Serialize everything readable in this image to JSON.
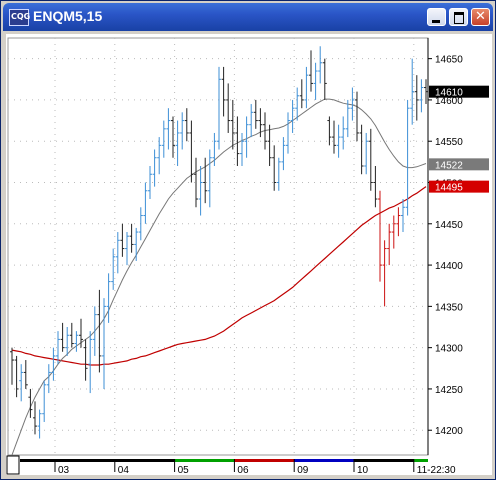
{
  "window": {
    "title": "ENQM5,15",
    "icon_text": "CQG"
  },
  "colors": {
    "up": "#3d8fd6",
    "down": "#222222",
    "red_bar": "#cc1111",
    "ma_fast": "#777777",
    "ma_slow": "#c00000",
    "tag_gray": "#7a7a7a",
    "tag_red": "#d40000",
    "tag_black": "#000000"
  },
  "chart_data": {
    "type": "ohlc",
    "title": "ENQM5,15",
    "ylim": [
      14170,
      14675
    ],
    "y_ticks": [
      "14650",
      "14600",
      "14550",
      "14500",
      "14450",
      "14400",
      "14350",
      "14300",
      "14250",
      "14200"
    ],
    "y_tick_values": [
      14650,
      14600,
      14550,
      14500,
      14450,
      14400,
      14350,
      14300,
      14250,
      14200
    ],
    "tags": [
      {
        "label": "14610",
        "value": 14610,
        "color": "black"
      },
      {
        "label": "14522",
        "value": 14522,
        "color": "gray"
      },
      {
        "label": "14495",
        "value": 14495,
        "color": "red"
      }
    ],
    "date_labels": [
      "03",
      "04",
      "05",
      "06",
      "09",
      "10",
      "11-22:30"
    ],
    "date_label_index": [
      10,
      23,
      36,
      49,
      62,
      75,
      88
    ],
    "date_band_colors": [
      "#000000",
      "#000000",
      "#00a000",
      "#c00000",
      "#0000c0",
      "#000000",
      "#00a000"
    ],
    "bars": [
      [
        14295,
        14300,
        14255,
        14285
      ],
      [
        14285,
        14290,
        14240,
        14250
      ],
      [
        14260,
        14280,
        14235,
        14270
      ],
      [
        14270,
        14285,
        14250,
        14255
      ],
      [
        14240,
        14250,
        14215,
        14225
      ],
      [
        14215,
        14235,
        14195,
        14205
      ],
      [
        14205,
        14225,
        14190,
        14220
      ],
      [
        14220,
        14260,
        14210,
        14255
      ],
      [
        14255,
        14280,
        14245,
        14270
      ],
      [
        14270,
        14300,
        14260,
        14290
      ],
      [
        14290,
        14320,
        14280,
        14310
      ],
      [
        14310,
        14330,
        14295,
        14300
      ],
      [
        14300,
        14325,
        14290,
        14315
      ],
      [
        14315,
        14330,
        14300,
        14305
      ],
      [
        14305,
        14320,
        14295,
        14315
      ],
      [
        14315,
        14335,
        14300,
        14310
      ],
      [
        14300,
        14310,
        14260,
        14275
      ],
      [
        14280,
        14320,
        14245,
        14310
      ],
      [
        14310,
        14350,
        14290,
        14340
      ],
      [
        14340,
        14370,
        14270,
        14290
      ],
      [
        14290,
        14360,
        14250,
        14350
      ],
      [
        14350,
        14390,
        14330,
        14380
      ],
      [
        14380,
        14420,
        14370,
        14410
      ],
      [
        14410,
        14440,
        14390,
        14430
      ],
      [
        14430,
        14450,
        14410,
        14420
      ],
      [
        14420,
        14440,
        14400,
        14435
      ],
      [
        14435,
        14450,
        14415,
        14425
      ],
      [
        14425,
        14445,
        14405,
        14440
      ],
      [
        14440,
        14470,
        14430,
        14460
      ],
      [
        14460,
        14500,
        14450,
        14490
      ],
      [
        14490,
        14520,
        14480,
        14510
      ],
      [
        14510,
        14540,
        14495,
        14530
      ],
      [
        14530,
        14555,
        14510,
        14545
      ],
      [
        14545,
        14575,
        14530,
        14565
      ],
      [
        14565,
        14590,
        14540,
        14575
      ],
      [
        14575,
        14580,
        14530,
        14545
      ],
      [
        14545,
        14575,
        14520,
        14560
      ],
      [
        14560,
        14585,
        14540,
        14575
      ],
      [
        14575,
        14590,
        14550,
        14560
      ],
      [
        14560,
        14575,
        14500,
        14510
      ],
      [
        14510,
        14530,
        14470,
        14480
      ],
      [
        14480,
        14520,
        14460,
        14500
      ],
      [
        14500,
        14530,
        14475,
        14490
      ],
      [
        14490,
        14540,
        14470,
        14530
      ],
      [
        14530,
        14560,
        14520,
        14550
      ],
      [
        14550,
        14640,
        14540,
        14625
      ],
      [
        14625,
        14640,
        14580,
        14600
      ],
      [
        14600,
        14620,
        14560,
        14575
      ],
      [
        14575,
        14600,
        14540,
        14560
      ],
      [
        14560,
        14580,
        14520,
        14535
      ],
      [
        14535,
        14560,
        14520,
        14550
      ],
      [
        14550,
        14580,
        14530,
        14570
      ],
      [
        14570,
        14595,
        14555,
        14585
      ],
      [
        14585,
        14600,
        14565,
        14575
      ],
      [
        14575,
        14590,
        14555,
        14570
      ],
      [
        14570,
        14585,
        14540,
        14550
      ],
      [
        14550,
        14570,
        14520,
        14530
      ],
      [
        14530,
        14545,
        14490,
        14500
      ],
      [
        14500,
        14530,
        14490,
        14525
      ],
      [
        14525,
        14555,
        14515,
        14545
      ],
      [
        14545,
        14585,
        14535,
        14575
      ],
      [
        14575,
        14600,
        14560,
        14590
      ],
      [
        14590,
        14615,
        14575,
        14605
      ],
      [
        14605,
        14625,
        14590,
        14600
      ],
      [
        14600,
        14640,
        14590,
        14630
      ],
      [
        14630,
        14660,
        14610,
        14620
      ],
      [
        14620,
        14645,
        14600,
        14635
      ],
      [
        14635,
        14665,
        14620,
        14645
      ],
      [
        14645,
        14650,
        14600,
        14620
      ],
      [
        14575,
        14580,
        14545,
        14555
      ],
      [
        14555,
        14575,
        14535,
        14545
      ],
      [
        14545,
        14570,
        14530,
        14555
      ],
      [
        14555,
        14580,
        14540,
        14565
      ],
      [
        14565,
        14600,
        14555,
        14590
      ],
      [
        14590,
        14615,
        14575,
        14600
      ],
      [
        14600,
        14610,
        14550,
        14560
      ],
      [
        14560,
        14570,
        14510,
        14520
      ],
      [
        14520,
        14560,
        14510,
        14550
      ],
      [
        14550,
        14565,
        14490,
        14500
      ],
      [
        14500,
        14520,
        14470,
        14480
      ],
      [
        14480,
        14490,
        14380,
        14400
      ],
      [
        14400,
        14430,
        14350,
        14420
      ],
      [
        14420,
        14450,
        14400,
        14440
      ],
      [
        14440,
        14460,
        14420,
        14450
      ],
      [
        14450,
        14470,
        14435,
        14460
      ],
      [
        14460,
        14480,
        14440,
        14470
      ],
      [
        14470,
        14600,
        14460,
        14590
      ],
      [
        14590,
        14650,
        14570,
        14610
      ],
      [
        14610,
        14630,
        14575,
        14600
      ],
      [
        14600,
        14625,
        14585,
        14615
      ],
      [
        14615,
        14625,
        14595,
        14610
      ]
    ],
    "ma_fast": [
      14170,
      14185,
      14200,
      14215,
      14228,
      14240,
      14250,
      14260,
      14265,
      14272,
      14280,
      14287,
      14292,
      14298,
      14302,
      14306,
      14310,
      14314,
      14320,
      14327,
      14335,
      14345,
      14358,
      14370,
      14382,
      14393,
      14403,
      14412,
      14422,
      14432,
      14442,
      14452,
      14462,
      14471,
      14480,
      14487,
      14493,
      14499,
      14505,
      14509,
      14513,
      14516,
      14519,
      14523,
      14527,
      14532,
      14537,
      14541,
      14545,
      14548,
      14551,
      14553,
      14556,
      14558,
      14561,
      14563,
      14564,
      14565,
      14566,
      14568,
      14571,
      14575,
      14579,
      14583,
      14587,
      14591,
      14595,
      14598,
      14601,
      14601,
      14600,
      14598,
      14596,
      14595,
      14594,
      14592,
      14588,
      14583,
      14577,
      14569,
      14559,
      14549,
      14540,
      14532,
      14525,
      14520,
      14518,
      14518,
      14519,
      14521,
      14523
    ],
    "ma_slow": [
      14297,
      14296,
      14295,
      14293,
      14292,
      14290,
      14289,
      14288,
      14287,
      14286,
      14285,
      14284,
      14283,
      14282,
      14281,
      14280,
      14280,
      14279,
      14279,
      14279,
      14280,
      14280,
      14281,
      14282,
      14283,
      14284,
      14286,
      14287,
      14289,
      14290,
      14292,
      14294,
      14296,
      14298,
      14300,
      14302,
      14304,
      14305,
      14306,
      14307,
      14308,
      14309,
      14310,
      14312,
      14314,
      14317,
      14320,
      14324,
      14328,
      14332,
      14336,
      14339,
      14342,
      14345,
      14348,
      14351,
      14354,
      14357,
      14361,
      14365,
      14369,
      14373,
      14378,
      14383,
      14388,
      14393,
      14398,
      14403,
      14408,
      14413,
      14418,
      14423,
      14428,
      14433,
      14438,
      14443,
      14448,
      14452,
      14456,
      14460,
      14463,
      14466,
      14469,
      14471,
      14474,
      14477,
      14480,
      14484,
      14487,
      14491,
      14495
    ]
  }
}
